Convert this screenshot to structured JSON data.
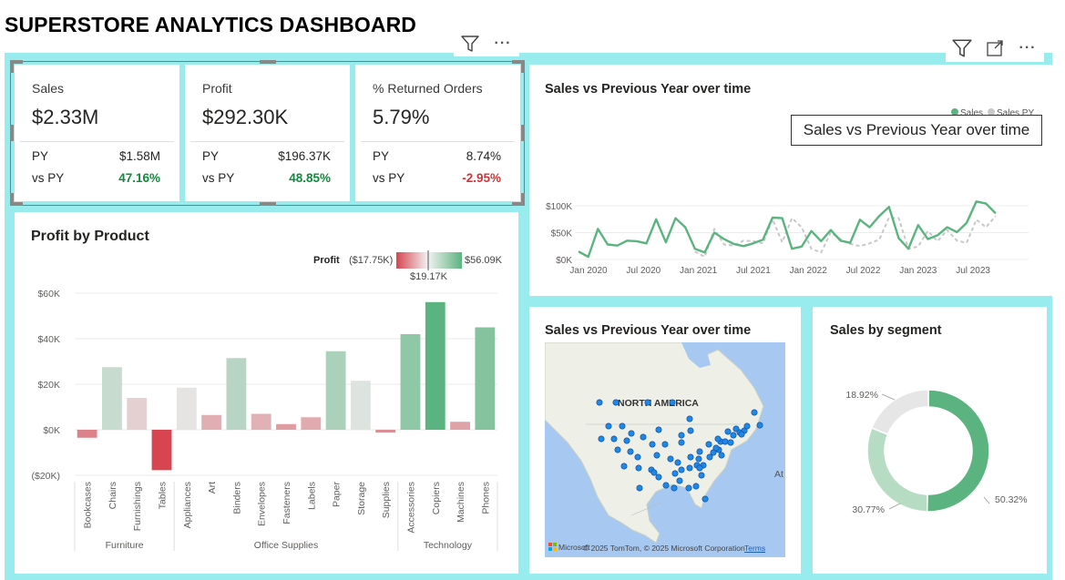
{
  "page": {
    "title": "SUPERSTORE ANALYTICS DASHBOARD"
  },
  "icons": {
    "filter": "filter-icon",
    "more": "more-options-icon",
    "focus": "focus-mode-icon"
  },
  "toolbar": {
    "more_label": "···"
  },
  "kpis": [
    {
      "title": "Sales",
      "value": "$2.33M",
      "py_label": "PY",
      "py_value": "$1.58M",
      "vs_label": "vs PY",
      "vs_value": "47.16%",
      "vs_color": "#118a3c"
    },
    {
      "title": "Profit",
      "value": "$292.30K",
      "py_label": "PY",
      "py_value": "$196.37K",
      "vs_label": "vs PY",
      "vs_value": "48.85%",
      "vs_color": "#118a3c"
    },
    {
      "title": "% Returned Orders",
      "value": "5.79%",
      "py_label": "PY",
      "py_value": "8.74%",
      "vs_label": "vs PY",
      "vs_value": "-2.95%",
      "vs_color": "#d13438"
    }
  ],
  "profit_chart": {
    "title": "Profit by Product",
    "legend": {
      "label": "Profit",
      "min_label": "($17.75K)",
      "mid_label": "$19.17K",
      "max_label": "$56.09K"
    },
    "colors": {
      "negative": "#d64550",
      "neutral": "#e6e6e6",
      "positive": "#5bb47f"
    }
  },
  "line_chart": {
    "title": "Sales vs Previous Year over time",
    "tooltip": "Sales vs Previous Year over time",
    "colors": {
      "sales": "#5bb47f",
      "py": "#c8c8c8"
    }
  },
  "map": {
    "title": "Sales vs Previous Year over time",
    "label_continent": "NORTH AMERICA",
    "label_ocean": "At",
    "attribution": "© 2025 TomTom, © 2025 Microsoft Corporation",
    "terms": "Terms",
    "brand": "Microsoft",
    "colors": {
      "water": "#a7c8f1",
      "land": "#eef0e8",
      "bubble": "#1e88e5"
    }
  },
  "segment": {
    "title": "Sales by segment",
    "colors": [
      "#5bb47f",
      "#b7dcc4",
      "#e6e6e6"
    ]
  },
  "chart_data": [
    {
      "type": "bar",
      "title": "Profit by Product",
      "categories": [
        "Bookcases",
        "Chairs",
        "Furnishings",
        "Tables",
        "Appliances",
        "Art",
        "Binders",
        "Envelopes",
        "Fasteners",
        "Labels",
        "Paper",
        "Storage",
        "Supplies",
        "Accessories",
        "Copiers",
        "Machines",
        "Phones"
      ],
      "groups": [
        {
          "name": "Furniture",
          "count": 4
        },
        {
          "name": "Office Supplies",
          "count": 9
        },
        {
          "name": "Technology",
          "count": 4
        }
      ],
      "values": [
        -3.5,
        27.5,
        14.0,
        -17.75,
        18.5,
        6.5,
        31.5,
        7.0,
        2.5,
        5.5,
        34.5,
        21.5,
        -1.2,
        42.0,
        56.09,
        3.5,
        45.0
      ],
      "ylim": [
        -20,
        60
      ],
      "yticks": [
        -20,
        0,
        20,
        40,
        60
      ],
      "ytick_labels": [
        "($20K)",
        "$0K",
        "$20K",
        "$40K",
        "$60K"
      ],
      "grid": true
    },
    {
      "type": "line",
      "title": "Sales vs Previous Year over time",
      "x_ticks": [
        "Jan 2020",
        "Jul 2020",
        "Jan 2021",
        "Jul 2021",
        "Jan 2022",
        "Jul 2022",
        "Jan 2023",
        "Jul 2023"
      ],
      "yticks": [
        0,
        50,
        100
      ],
      "ytick_labels": [
        "$0K",
        "$50K",
        "$100K"
      ],
      "ylim": [
        0,
        110
      ],
      "legend": {
        "position": "top-right",
        "entries": [
          "Sales",
          "Sales PY"
        ]
      },
      "series": [
        {
          "name": "Sales",
          "values": [
            15,
            5,
            57,
            28,
            26,
            35,
            34,
            30,
            75,
            32,
            77,
            60,
            20,
            13,
            50,
            38,
            29,
            25,
            30,
            37,
            78,
            77,
            20,
            24,
            53,
            34,
            55,
            35,
            31,
            74,
            60,
            81,
            98,
            40,
            20,
            64,
            38,
            45,
            60,
            51,
            68,
            108,
            104,
            86
          ]
        },
        {
          "name": "Sales PY",
          "values": [
            null,
            null,
            null,
            null,
            null,
            null,
            null,
            null,
            null,
            null,
            null,
            null,
            15,
            5,
            57,
            28,
            26,
            35,
            34,
            30,
            75,
            32,
            77,
            60,
            20,
            13,
            50,
            38,
            29,
            25,
            30,
            37,
            78,
            77,
            20,
            24,
            53,
            34,
            55,
            35,
            31,
            74,
            60,
            81
          ]
        }
      ]
    },
    {
      "type": "pie",
      "title": "Sales by segment",
      "labels": [
        "50.32%",
        "30.77%",
        "18.92%"
      ],
      "values": [
        50.32,
        30.77,
        18.92
      ]
    }
  ]
}
